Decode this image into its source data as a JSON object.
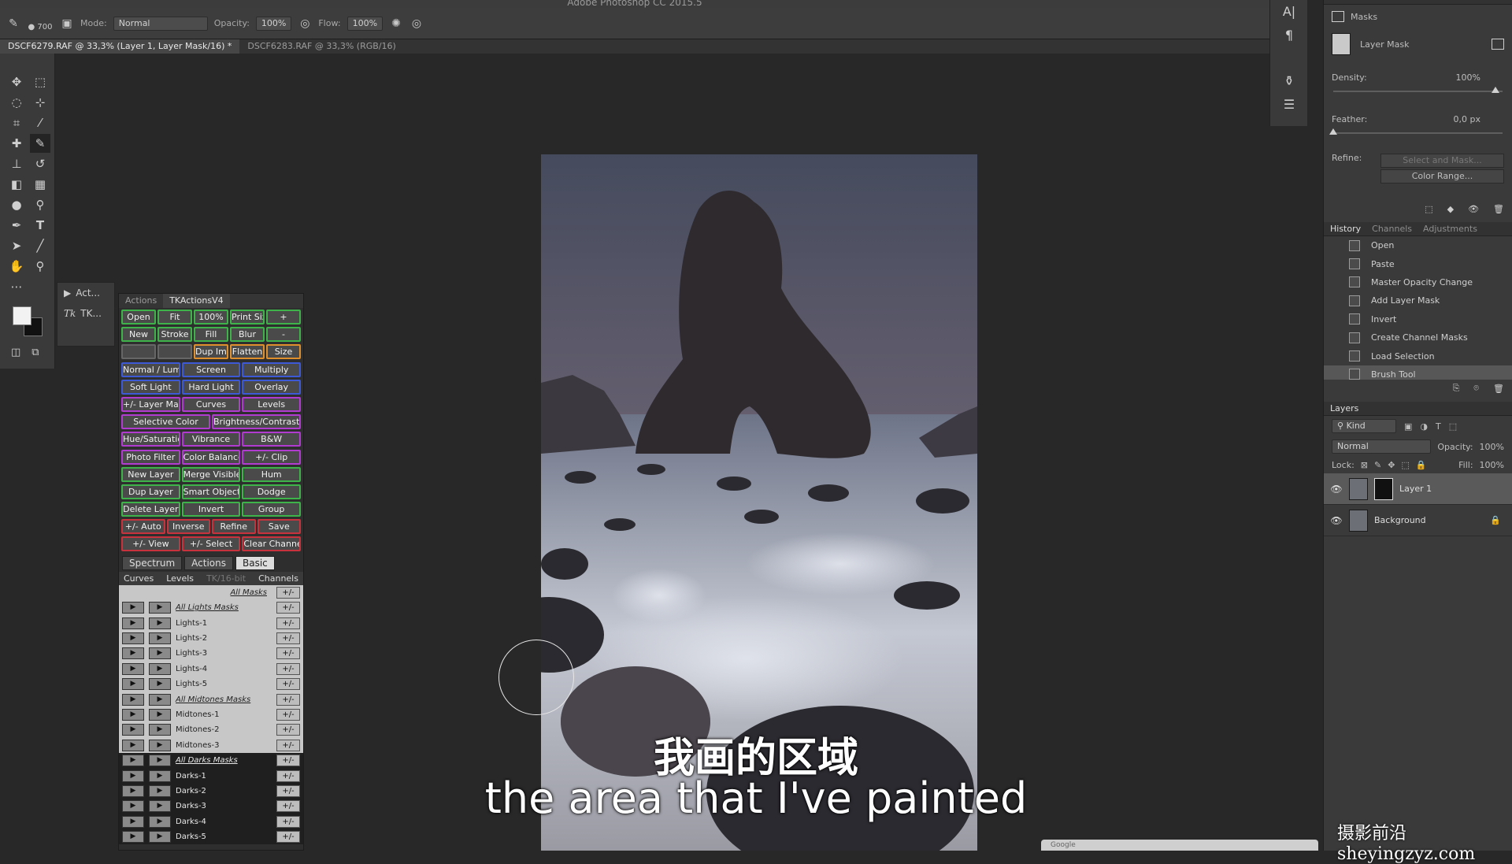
{
  "app": {
    "title": "Adobe Photoshop CC 2015.5"
  },
  "options": {
    "brush_size": "700",
    "mode_label": "Mode:",
    "mode_value": "Normal",
    "opacity_label": "Opacity:",
    "opacity_value": "100%",
    "flow_label": "Flow:",
    "flow_value": "100%"
  },
  "documents": [
    {
      "label": "DSCF6279.RAF @ 33,3% (Layer 1, Layer Mask/16) *"
    },
    {
      "label": "DSCF6283.RAF @ 33,3% (RGB/16)"
    }
  ],
  "mini_panel": {
    "actions_label": "Act...",
    "tk_label": "TK..."
  },
  "tk_panel": {
    "tabs": [
      "Actions",
      "TKActionsV4"
    ],
    "button_rows": [
      [
        {
          "l": "Open",
          "c": "#3db34a"
        },
        {
          "l": "Fit",
          "c": "#3db34a"
        },
        {
          "l": "100%",
          "c": "#3db34a"
        },
        {
          "l": "Print Size",
          "c": "#3db34a"
        },
        {
          "l": "+",
          "c": "#3db34a"
        }
      ],
      [
        {
          "l": "New",
          "c": "#3db34a"
        },
        {
          "l": "Stroke",
          "c": "#3db34a"
        },
        {
          "l": "Fill",
          "c": "#3db34a"
        },
        {
          "l": "Blur",
          "c": "#3db34a"
        },
        {
          "l": "-",
          "c": "#3db34a"
        }
      ],
      [
        {
          "l": "",
          "c": "#666"
        },
        {
          "l": "",
          "c": "#666"
        },
        {
          "l": "Dup Image",
          "c": "#e08f2d"
        },
        {
          "l": "Flatten",
          "c": "#e08f2d"
        },
        {
          "l": "Size",
          "c": "#e08f2d"
        }
      ],
      [
        {
          "l": "Normal / Lum",
          "c": "#3d59d6"
        },
        {
          "l": "Screen",
          "c": "#3d59d6"
        },
        {
          "l": "Multiply",
          "c": "#3d59d6"
        }
      ],
      [
        {
          "l": "Soft Light",
          "c": "#3d59d6"
        },
        {
          "l": "Hard Light",
          "c": "#3d59d6"
        },
        {
          "l": "Overlay",
          "c": "#3d59d6"
        }
      ],
      [
        {
          "l": "+/- Layer Mask",
          "c": "#b13ad0"
        },
        {
          "l": "Curves",
          "c": "#b13ad0"
        },
        {
          "l": "Levels",
          "c": "#b13ad0"
        }
      ],
      [
        {
          "l": "Selective Color",
          "c": "#b13ad0"
        },
        {
          "l": "Brightness/Contrast",
          "c": "#b13ad0"
        }
      ],
      [
        {
          "l": "Hue/Saturation",
          "c": "#b13ad0"
        },
        {
          "l": "Vibrance",
          "c": "#b13ad0"
        },
        {
          "l": "B&W",
          "c": "#b13ad0"
        }
      ],
      [
        {
          "l": "Photo Filter",
          "c": "#b13ad0"
        },
        {
          "l": "Color Balance",
          "c": "#b13ad0"
        },
        {
          "l": "+/- Clip",
          "c": "#b13ad0"
        }
      ],
      [
        {
          "l": "New Layer",
          "c": "#3db34a"
        },
        {
          "l": "Merge Visible",
          "c": "#3db34a"
        },
        {
          "l": "Hum",
          "c": "#3db34a"
        }
      ],
      [
        {
          "l": "Dup Layer",
          "c": "#3db34a"
        },
        {
          "l": "Smart Object",
          "c": "#3db34a"
        },
        {
          "l": "Dodge",
          "c": "#3db34a"
        }
      ],
      [
        {
          "l": "Delete Layer",
          "c": "#3db34a"
        },
        {
          "l": "Invert",
          "c": "#3db34a"
        },
        {
          "l": "Group",
          "c": "#3db34a"
        }
      ],
      [
        {
          "l": "+/- Auto",
          "c": "#c8323c"
        },
        {
          "l": "Inverse",
          "c": "#c8323c"
        },
        {
          "l": "Refine",
          "c": "#c8323c"
        },
        {
          "l": "Save",
          "c": "#c8323c"
        }
      ],
      [
        {
          "l": "+/- View",
          "c": "#c8323c"
        },
        {
          "l": "+/- Select",
          "c": "#c8323c"
        },
        {
          "l": "Clear Channels",
          "c": "#c8323c"
        }
      ]
    ],
    "sub_tabs": [
      "Spectrum",
      "Actions",
      "Basic"
    ],
    "sub_heads": [
      "Curves",
      "Levels",
      "TK/16-bit",
      "Channels"
    ],
    "all_masks": "All Masks",
    "mask_rows": [
      {
        "l": "All Lights Masks",
        "dark": false
      },
      {
        "l": "Lights-1",
        "dark": false
      },
      {
        "l": "Lights-2",
        "dark": false
      },
      {
        "l": "Lights-3",
        "dark": false
      },
      {
        "l": "Lights-4",
        "dark": false
      },
      {
        "l": "Lights-5",
        "dark": false
      },
      {
        "l": "All Midtones Masks",
        "dark": false
      },
      {
        "l": "Midtones-1",
        "dark": false
      },
      {
        "l": "Midtones-2",
        "dark": false
      },
      {
        "l": "Midtones-3",
        "dark": false
      },
      {
        "l": "All Darks Masks",
        "dark": true
      },
      {
        "l": "Darks-1",
        "dark": true
      },
      {
        "l": "Darks-2",
        "dark": true
      },
      {
        "l": "Darks-3",
        "dark": true
      },
      {
        "l": "Darks-4",
        "dark": true
      },
      {
        "l": "Darks-5",
        "dark": true
      }
    ],
    "pm_label": "+/-"
  },
  "properties": {
    "section": "Masks",
    "layer_mask": "Layer Mask",
    "density_label": "Density:",
    "density_value": "100%",
    "density_fraction": 1.0,
    "feather_label": "Feather:",
    "feather_value": "0,0 px",
    "feather_fraction": 0.0,
    "refine_label": "Refine:",
    "select_mask_btn": "Select and Mask...",
    "color_range_btn": "Color Range..."
  },
  "history": {
    "tabs": [
      "History",
      "Channels",
      "Adjustments"
    ],
    "items": [
      "Open",
      "Paste",
      "Master Opacity Change",
      "Add Layer Mask",
      "Invert",
      "Create Channel Masks",
      "Load Selection",
      "Brush Tool"
    ]
  },
  "layers": {
    "title": "Layers",
    "kind_filter": "Kind",
    "blend_mode": "Normal",
    "opacity_label": "Opacity:",
    "opacity_value": "100%",
    "lock_label": "Lock:",
    "fill_label": "Fill:",
    "fill_value": "100%",
    "items": [
      {
        "name": "Layer 1"
      },
      {
        "name": "Background"
      }
    ]
  },
  "subtitles": {
    "chinese": "我画的区域",
    "english": "the area that I've painted"
  },
  "watermark": "摄影前沿 sheyingzyz.com",
  "google_bar": "Google"
}
